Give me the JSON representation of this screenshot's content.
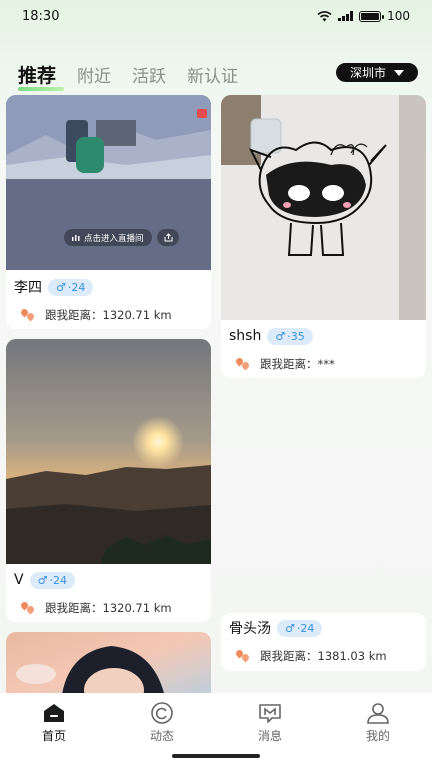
{
  "status": {
    "time": "18:30",
    "battery": "100"
  },
  "tabs": [
    {
      "label": "推荐",
      "active": true
    },
    {
      "label": "附近",
      "active": false
    },
    {
      "label": "活跃",
      "active": false
    },
    {
      "label": "新认证",
      "active": false
    }
  ],
  "city": "深圳市",
  "cards": [
    {
      "name": "李四",
      "gender": "♂",
      "age": "·24",
      "distance_label": "跟我距离：",
      "distance": "1320.71 km",
      "live_label": "点击进入直播间"
    },
    {
      "name": "shsh",
      "gender": "♂",
      "age": "·35",
      "distance_label": "跟我距离：",
      "distance": "***"
    },
    {
      "name": "V",
      "gender": "♂",
      "age": "·24",
      "distance_label": "跟我距离：",
      "distance": "1320.71 km"
    },
    {
      "name": "骨头汤",
      "gender": "♂",
      "age": "·24",
      "distance_label": "跟我距离：",
      "distance": "1381.03 km"
    }
  ],
  "nav": [
    {
      "label": "首页",
      "icon": "home-icon",
      "active": true
    },
    {
      "label": "动态",
      "icon": "moments-icon",
      "active": false
    },
    {
      "label": "消息",
      "icon": "message-icon",
      "active": false
    },
    {
      "label": "我的",
      "icon": "profile-icon",
      "active": false
    }
  ],
  "colors": {
    "accent": "#6fd97a",
    "age_badge_bg": "#dcebfa",
    "age_badge_text": "#3a8fe0",
    "location": "#f08a5d"
  }
}
